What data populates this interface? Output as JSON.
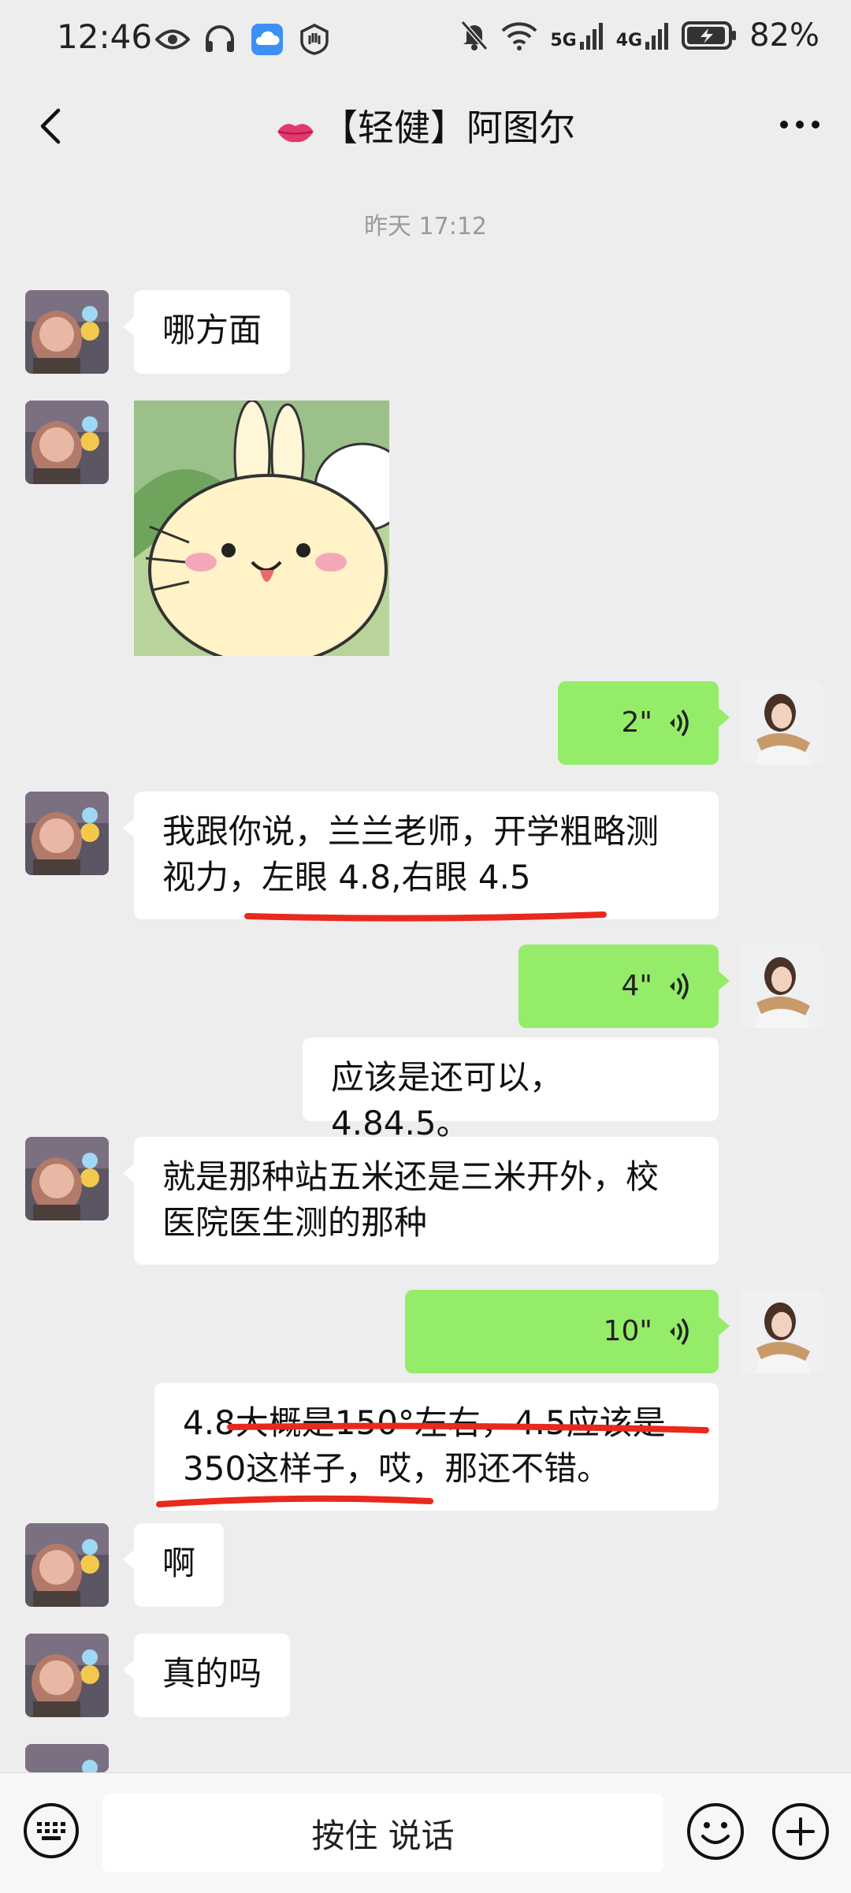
{
  "status_bar": {
    "time": "12:46",
    "net_a": "5G",
    "net_b": "4G",
    "battery": "82%"
  },
  "header": {
    "title": "【轻健】阿图尔"
  },
  "chat": {
    "timestamp": "昨天 17:12",
    "messages": [
      {
        "side": "left",
        "type": "text",
        "text": "哪方面"
      },
      {
        "side": "left",
        "type": "sticker"
      },
      {
        "side": "right",
        "type": "voice",
        "duration": "2\""
      },
      {
        "side": "left",
        "type": "text",
        "lines": [
          "我跟你说，兰兰老师，开学粗略测",
          "视力，左眼 4.8,右眼 4.5"
        ]
      },
      {
        "side": "right",
        "type": "voice",
        "duration": "4\""
      },
      {
        "side": "right",
        "type": "text",
        "text": "应该是还可以，4.84.5。"
      },
      {
        "side": "left",
        "type": "text",
        "lines": [
          "就是那种站五米还是三米开外，校",
          "医院医生测的那种"
        ]
      },
      {
        "side": "right",
        "type": "voice",
        "duration": "10\""
      },
      {
        "side": "right",
        "type": "text",
        "lines": [
          "4.8大概是150°左右，4.5应该是",
          "350这样子，哎，那还不错。"
        ]
      },
      {
        "side": "left",
        "type": "text",
        "text": "啊"
      },
      {
        "side": "left",
        "type": "text",
        "text": "真的吗"
      }
    ]
  },
  "input_bar": {
    "hold_to_talk": "按住 说话"
  },
  "colors": {
    "background": "#ededed",
    "bubble_green": "#95ec69",
    "bubble_white": "#ffffff",
    "annotation_red": "#e8291c"
  }
}
